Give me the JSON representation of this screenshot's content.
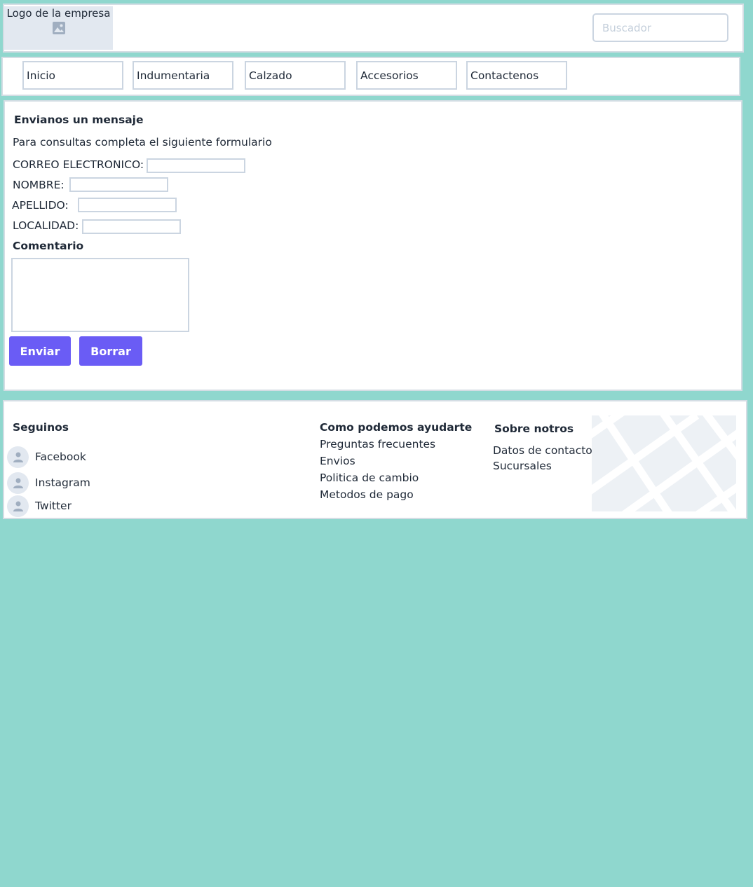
{
  "header": {
    "logo_text": "Logo de la empresa",
    "search_placeholder": "Buscador"
  },
  "nav": {
    "items": [
      "Inicio",
      "Indumentaria",
      "Calzado",
      "Accesorios",
      "Contactenos"
    ]
  },
  "form": {
    "title": "Envianos un mensaje",
    "subtitle": "Para consultas completa el siguiente formulario",
    "email_label": "CORREO ELECTRONICO:",
    "name_label": "NOMBRE:",
    "lastname_label": "APELLIDO:",
    "locality_label": "LOCALIDAD:",
    "comment_label": "Comentario",
    "submit_label": "Enviar",
    "reset_label": "Borrar"
  },
  "footer": {
    "follow": {
      "heading": "Seguinos",
      "items": [
        "Facebook",
        "Instagram",
        "Twitter"
      ]
    },
    "help": {
      "heading": "Como podemos ayudarte",
      "items": [
        "Preguntas frecuentes",
        "Envios",
        "Politica de cambio",
        "Metodos de pago"
      ]
    },
    "about": {
      "heading": "Sobre notros",
      "items": [
        "Datos de contacto",
        "Sucursales"
      ]
    }
  },
  "colors": {
    "background": "#8fd7ce",
    "button": "#6a5cf5",
    "border": "#cbd5e1"
  }
}
